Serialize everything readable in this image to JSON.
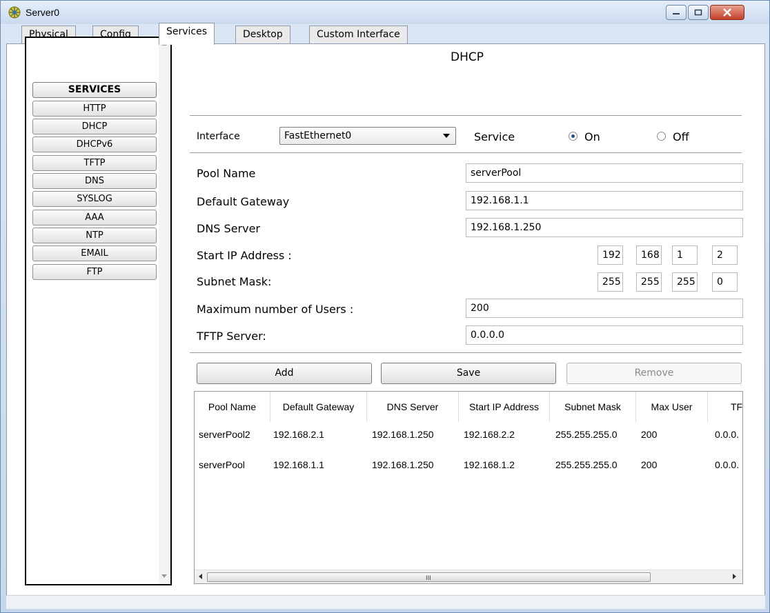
{
  "window": {
    "title": "Server0"
  },
  "tabs": [
    {
      "label": "Physical",
      "active": false
    },
    {
      "label": "Config",
      "active": false
    },
    {
      "label": "Services",
      "active": true
    },
    {
      "label": "Desktop",
      "active": false
    },
    {
      "label": "Custom Interface",
      "active": false
    }
  ],
  "services": {
    "header": "SERVICES",
    "items": [
      "HTTP",
      "DHCP",
      "DHCPv6",
      "TFTP",
      "DNS",
      "SYSLOG",
      "AAA",
      "NTP",
      "EMAIL",
      "FTP"
    ]
  },
  "dhcp": {
    "title": "DHCP",
    "interface_label": "Interface",
    "interface_value": "FastEthernet0",
    "service_label": "Service",
    "on_label": "On",
    "off_label": "Off",
    "service_state": "On",
    "pool_name_label": "Pool Name",
    "pool_name_value": "serverPool",
    "gateway_label": "Default Gateway",
    "gateway_value": "192.168.1.1",
    "dns_label": "DNS Server",
    "dns_value": "192.168.1.250",
    "start_ip_label": "Start IP Address :",
    "start_ip": [
      "192",
      "168",
      "1",
      "2"
    ],
    "subnet_label": "Subnet Mask:",
    "subnet": [
      "255",
      "255",
      "255",
      "0"
    ],
    "max_users_label": "Maximum number of Users :",
    "max_users_value": "200",
    "tftp_label": "TFTP Server:",
    "tftp_value": "0.0.0.0",
    "add_label": "Add",
    "save_label": "Save",
    "remove_label": "Remove"
  },
  "table": {
    "headers": [
      "Pool Name",
      "Default Gateway",
      "DNS Server",
      "Start IP Address",
      "Subnet Mask",
      "Max User",
      "TF"
    ],
    "rows": [
      [
        "serverPool2",
        "192.168.2.1",
        "192.168.1.250",
        "192.168.2.2",
        "255.255.255.0",
        "200",
        "0.0.0."
      ],
      [
        "serverPool",
        "192.168.1.1",
        "192.168.1.250",
        "192.168.1.2",
        "255.255.255.0",
        "200",
        "0.0.0."
      ]
    ],
    "scroll_grip": "III"
  },
  "colors": {
    "radio_selected": "#2a4f8f",
    "close_button": "#c2412a"
  }
}
